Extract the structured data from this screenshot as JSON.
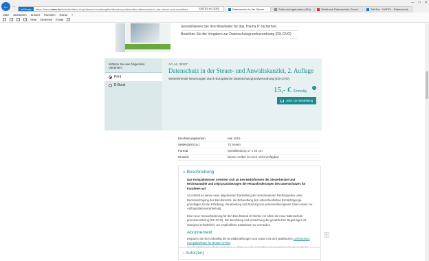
{
  "browser": {
    "mode_label": "InPrivate",
    "url_prefix": "https://www.",
    "url_domain": "datev.de",
    "url_rest": "/web/de/datev-shop/steuern-beratung/fachliteratur-printmedien-datenschutz-in-der-steuer-und-anwaltska",
    "ssl_label": "DATEV eG [DE]",
    "tabs": [
      {
        "label": "Datenschutz in der Steuer- ...",
        "active": true
      },
      {
        "label": "Seite nicht gefunden (404)",
        "active": false
      },
      {
        "label": "Workbook Datenschutz-Grund...",
        "active": false
      },
      {
        "label": "TeleTax - DATEV - Datenschut...",
        "active": false
      }
    ],
    "menu": [
      "Datei",
      "Bearbeiten",
      "Ansicht",
      "Favoriten",
      "Extras",
      "?"
    ],
    "toolbar": [
      "Seite",
      "Sicherheit",
      "Extras"
    ]
  },
  "top_bullets": [
    "Sensibilisieren Sie Ihre Mitarbeiter für das Thema IT-Sicherheit",
    "Beachten Sie die Vorgaben zur Datenschutzgrundverordnung (DS-GVO)"
  ],
  "variants": {
    "heading": "Wählen Sie aus folgenden Varianten:",
    "options": [
      {
        "label": "Print",
        "selected": true
      },
      {
        "label": "E-Book",
        "selected": false
      }
    ]
  },
  "product": {
    "art_nr": "Art.-Nr. 35207",
    "title": "Datenschutz in der Steuer- und Anwaltskanzlei, 2. Auflage",
    "subtitle": "Weitreichende Neuerungen durch Europäische Datenschutzgrundverordnung (DS-GVO)",
    "price": "15,- €",
    "price_note": "Einmalig",
    "info_symbol": "i",
    "order_button": "Jetzt zur Bestellung"
  },
  "details": [
    {
      "key": "Erscheinungstermin",
      "value": "Mai 2018"
    },
    {
      "key": "Seitenzahl (ca.)",
      "value": "70 Seiten"
    },
    {
      "key": "Format",
      "value": "Spiralbindung 17 x 24 cm"
    },
    {
      "key": "Hinweis",
      "value": "Dieser Artikel ist noch nicht verfügbar."
    }
  ],
  "description": {
    "heading": "Beschreibung",
    "intro": "Das Kompaktwissen orientiert sich an den Bedürfnissen der Steuerberater und Rechtsanwälte und zeigt praxisbezogen die Herausforderungen des Datenschutzes für Kanzleien auf.",
    "p1": "So enthält es neben einer allgemeinen Darstellung der verschiedenen Rechtsquellen unter Berücksichtigung des Berufsrechts, die Behandlung der unterschiedlichen Ermächtigungs-grundlagen für die Erhebung, Verarbeitung und Nutzung von personenbezogenen Daten sowie zur Auftragsdatenverarbeitung.",
    "p2": "Eine neue Herausforderung für den Berufsstand ist hierbei vor allem die neue Datenschutz-grundverordnung (DS-GVO). Die Beachtung und Umsetzung der gesetzlichen Regelungen ist zwingend erforderlich, um empfindliche Sanktionen zu vermeiden.",
    "abo_heading": "Abonnement",
    "abo_text_before": "Ersparen Sie sich zukünftig die Einzelbestellungen und nutzen Sie den praktischen ",
    "abo_link": "Lieferservice Kompaktwissen für Berater (Print)",
    "abo_text_after": ".",
    "abo_text2": "Damit erhalten Sie ab der nächsten Auslieferung alle zukünftigen Kompaktwissen (dieser Reihe automatisch nach Erscheinen am Printausgabe."
  },
  "authors": {
    "heading": "Autor(en)"
  },
  "scroll_top_symbol": "˄"
}
